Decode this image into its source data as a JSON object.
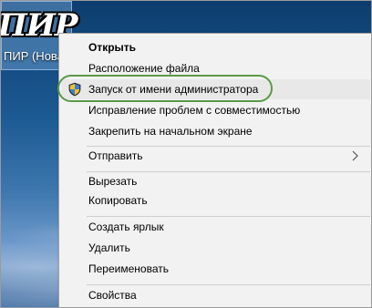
{
  "desktop": {
    "shortcut": {
      "icon_text": "ПИР",
      "label": "ПИР (Нова"
    }
  },
  "context_menu": {
    "items": [
      {
        "label": "Открыть"
      },
      {
        "label": "Расположение файла"
      },
      {
        "label": "Запуск от имени администратора",
        "icon": "uac-shield-icon"
      },
      {
        "label": "Исправление проблем с совместимостью"
      },
      {
        "label": "Закрепить на начальном экране"
      },
      {
        "label": "Отправить",
        "icon": "chevron-right-icon"
      },
      {
        "label": "Вырезать"
      },
      {
        "label": "Копировать"
      },
      {
        "label": "Создать ярлык"
      },
      {
        "label": "Удалить"
      },
      {
        "label": "Переименовать"
      },
      {
        "label": "Свойства"
      }
    ]
  },
  "colors": {
    "highlight_ring": "#5a9a46",
    "menu_background": "#f2f2f2"
  }
}
